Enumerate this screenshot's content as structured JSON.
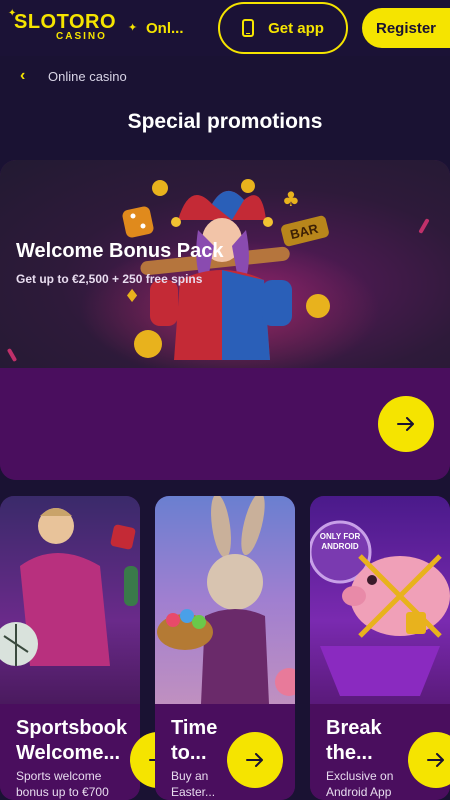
{
  "header": {
    "logo_brand": "SLOTORO",
    "logo_sub": "CASINO",
    "online_label": "Onl...",
    "get_app_label": "Get app",
    "register_label": "Register"
  },
  "breadcrumb": {
    "label": "Online casino"
  },
  "page_title": "Special promotions",
  "hero": {
    "title": "Welcome Bonus Pack",
    "subtitle": "Get up to €2,500 + 250 free spins",
    "badge_text": "BAR"
  },
  "cards": [
    {
      "title": "Sportsbook\nWelcome...",
      "desc": "Sports welcome\nbonus up to €700"
    },
    {
      "title": "Time\nto...",
      "desc": "Buy an\nEaster..."
    },
    {
      "title": "Break\nthe...",
      "desc": "Exclusive on\nAndroid App",
      "badge": "ONLY FOR\nANDROID"
    }
  ],
  "colors": {
    "accent": "#f5e400",
    "background": "#1a1233",
    "card": "#4a0e5e"
  }
}
